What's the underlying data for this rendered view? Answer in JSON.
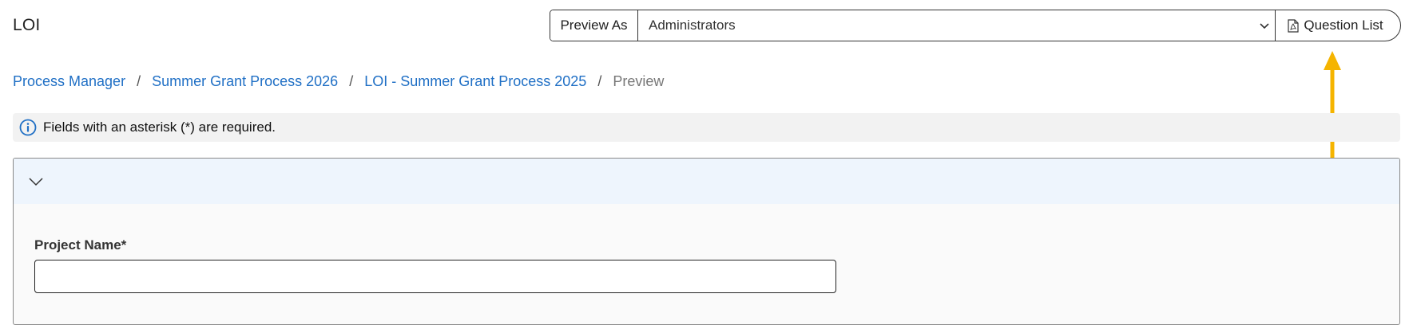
{
  "header": {
    "title": "LOI",
    "preview_as_label": "Preview As",
    "preview_as_selected": "Administrators",
    "question_list_label": "Question List"
  },
  "breadcrumb": {
    "items": [
      "Process Manager",
      "Summer Grant Process 2026",
      "LOI - Summer Grant Process 2025"
    ],
    "current": "Preview",
    "separator": "/"
  },
  "info_banner": {
    "text": "Fields with an asterisk (*) are required."
  },
  "section": {
    "fields": [
      {
        "label": "Project Name*",
        "value": "",
        "placeholder": ""
      }
    ]
  },
  "colors": {
    "link": "#1f6fc5",
    "section_header_bg": "#eef5fd",
    "banner_bg": "#f2f2f2",
    "annotation_arrow": "#f5b400"
  },
  "icons": {
    "info": "info-circle-icon",
    "pdf": "file-pdf-icon",
    "dropdown": "chevron-down-icon",
    "collapse": "chevron-down-icon"
  }
}
